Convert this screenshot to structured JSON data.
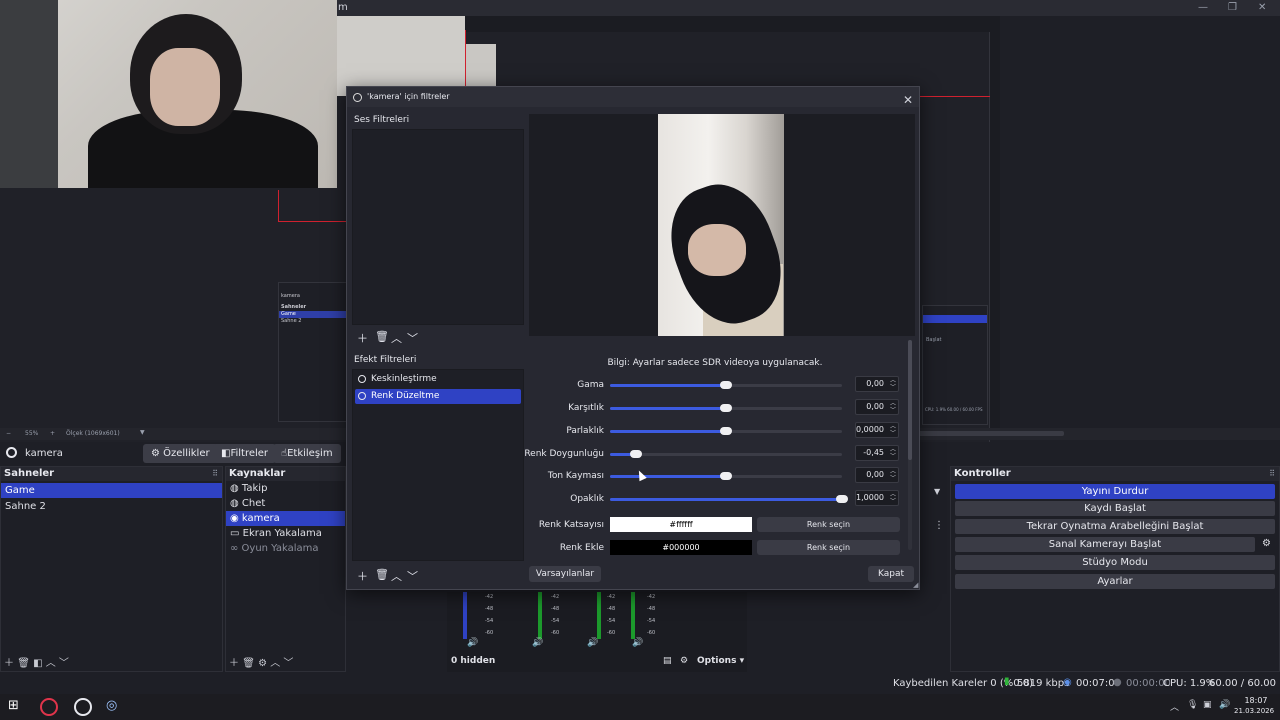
{
  "window": {
    "title_fragment": "m",
    "controls": [
      "—",
      "❐",
      "✕"
    ]
  },
  "preview": {
    "zoom": "55%",
    "scale": "Ölçek (1069x601)",
    "mini_header": "kamera",
    "mini_scenes_title": "Sahneler",
    "mini_game": "Game",
    "mini_scene2": "Sahne 2",
    "right_strip_text": "Başlat",
    "right_strip_status": "CPU: 1.9%   60.00 / 60.00 FPS"
  },
  "source_bar": {
    "source_name": "kamera",
    "properties": "Özellikler",
    "filters": "Filtreler",
    "interact": "Etkileşim"
  },
  "scenes": {
    "title": "Sahneler",
    "items": [
      "Game",
      "Sahne 2"
    ],
    "selected": 0
  },
  "sources": {
    "title": "Kaynaklar",
    "items": [
      {
        "label": "Takip",
        "icon": "browser-icon"
      },
      {
        "label": "Chet",
        "icon": "browser-icon"
      },
      {
        "label": "kamera",
        "icon": "camera-icon"
      },
      {
        "label": "Ekran Yakalama",
        "icon": "monitor-icon"
      },
      {
        "label": "Oyun Yakalama",
        "icon": "gamepad-icon"
      }
    ],
    "selected": 2
  },
  "mixer": {
    "ticks": [
      "-42",
      "-48",
      "-54",
      "-60"
    ],
    "hidden": "0 hidden",
    "options": "Options"
  },
  "controls": {
    "title": "Kontroller",
    "buttons": [
      "Yayını Durdur",
      "Kaydı Başlat",
      "Tekrar Oynatma Arabelleğini Başlat",
      "Sanal Kamerayı Başlat",
      "Stüdyo Modu",
      "Ayarlar"
    ]
  },
  "status": {
    "dropped": "Kaybedilen Kareler 0 (%0.0)",
    "bitrate": "5819 kbps",
    "stream_time": "00:07:09",
    "rec_time": "00:00:00",
    "cpu": "CPU: 1.9%",
    "fps": "60.00 / 60.00 FPS"
  },
  "taskbar": {
    "time": "18:07",
    "date": "21.03.2026"
  },
  "dialog": {
    "title": "'kamera' için filtreler",
    "audio_filters_label": "Ses Filtreleri",
    "effect_filters_label": "Efekt Filtreleri",
    "effect_filters": [
      {
        "label": "Keskinleştirme"
      },
      {
        "label": "Renk Düzeltme"
      }
    ],
    "selected_filter": 1,
    "info": "Bilgi: Ayarlar sadece SDR videoya uygulanacak.",
    "props": [
      {
        "label": "Gama",
        "value": "0,00",
        "fraction": 0.5
      },
      {
        "label": "Karşıtlık",
        "value": "0,00",
        "fraction": 0.5
      },
      {
        "label": "Parlaklık",
        "value": "0,0000",
        "fraction": 0.5
      },
      {
        "label": "Renk Doygunluğu",
        "value": "-0,45",
        "fraction": 0.11
      },
      {
        "label": "Ton Kayması",
        "value": "0,00",
        "fraction": 0.5
      },
      {
        "label": "Opaklık",
        "value": "1,0000",
        "fraction": 1.0
      }
    ],
    "multiply": {
      "label": "Renk Katsayısı",
      "value": "#ffffff",
      "button": "Renk seçin"
    },
    "add": {
      "label": "Renk Ekle",
      "value": "#000000",
      "button": "Renk seçin"
    },
    "defaults_button": "Varsayılanlar",
    "close_button": "Kapat"
  },
  "colors": {
    "accent": "#2f42c4",
    "slider": "#3c5be0",
    "bg": "#1e1f26"
  }
}
